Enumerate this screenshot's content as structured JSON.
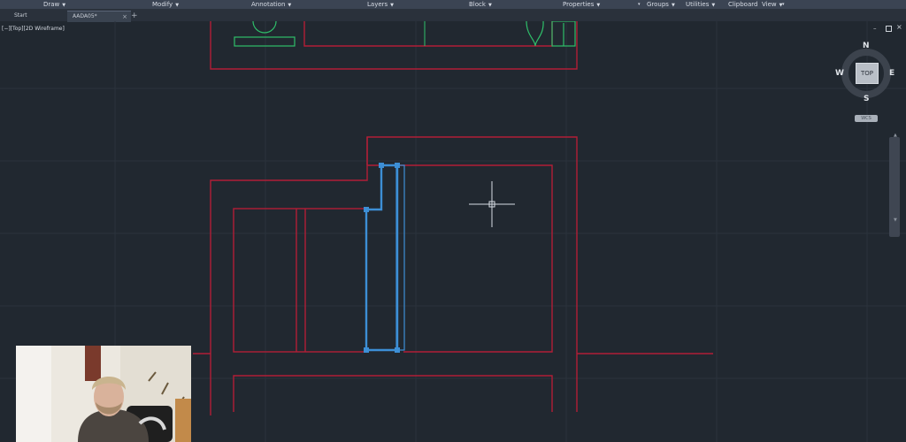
{
  "ribbon": {
    "panels": [
      {
        "label": "Draw"
      },
      {
        "label": "Modify"
      },
      {
        "label": "Annotation"
      },
      {
        "label": "Layers"
      },
      {
        "label": "Block"
      },
      {
        "label": "Properties"
      },
      {
        "label": "Groups"
      },
      {
        "label": "Utilities"
      },
      {
        "label": "Clipboard"
      },
      {
        "label": "View"
      }
    ]
  },
  "tabs": {
    "start_label": "Start",
    "file_label": "AADA05*",
    "close_glyph": "×",
    "new_tab_glyph": "+"
  },
  "viewport": {
    "label": "[−][Top][2D Wireframe]"
  },
  "viewcube": {
    "north": "N",
    "south": "S",
    "east": "E",
    "west": "W",
    "face": "TOP",
    "wcs_label": "WCS"
  },
  "colors": {
    "background": "#212830",
    "wall_lines": "#b11e37",
    "selected_object": "#3d8fd6",
    "furniture": "#2fbf6a"
  },
  "icons": {
    "crosshair": "crosshair-cursor-icon",
    "dropdown": "chevron-down-icon"
  }
}
